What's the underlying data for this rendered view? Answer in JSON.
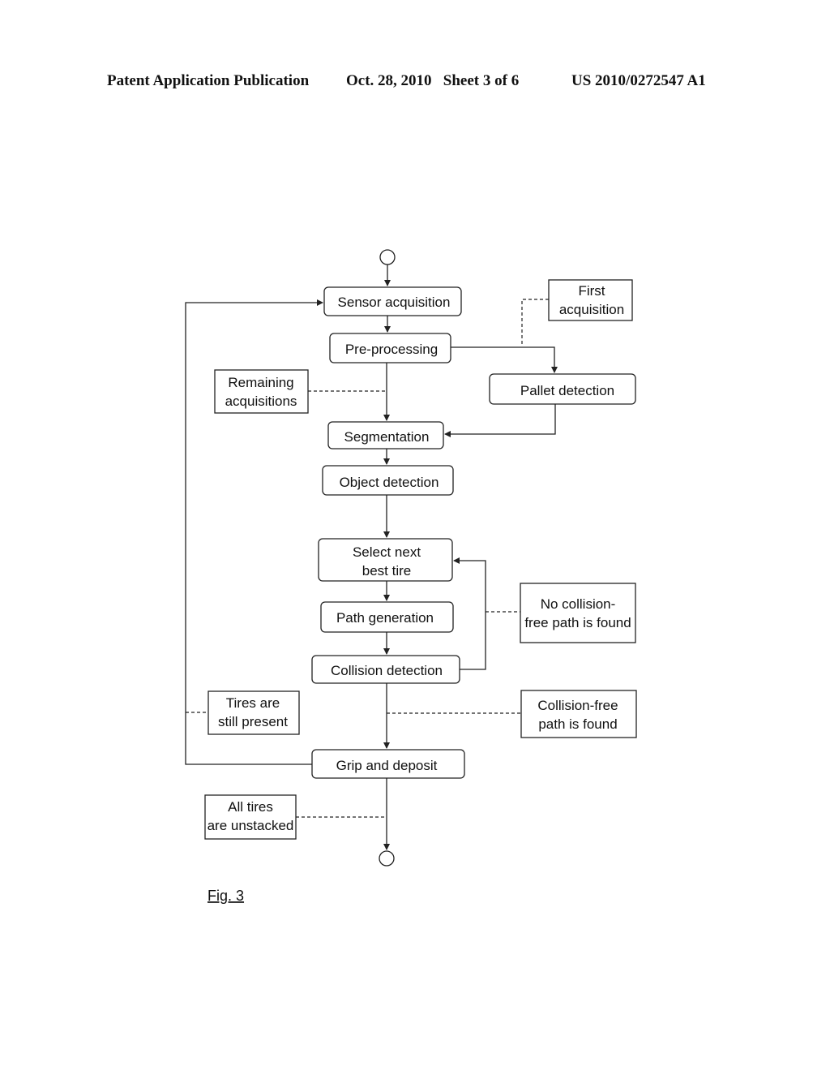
{
  "header": {
    "left": "Patent Application Publication",
    "middle": "Oct. 28, 2010   Sheet 3 of 6",
    "right": "US 2010/0272547 A1"
  },
  "figure_label": "Fig. 3",
  "steps": {
    "sensor_acquisition": "Sensor acquisition",
    "pre_processing": "Pre-processing",
    "pallet_detection": "Pallet detection",
    "segmentation": "Segmentation",
    "object_detection": "Object detection",
    "select_next_line1": "Select next",
    "select_next_line2": "best tire",
    "path_generation": "Path generation",
    "collision_detection": "Collision detection",
    "grip_and_deposit": "Grip and deposit"
  },
  "conditions": {
    "first_acq_line1": "First",
    "first_acq_line2": "acquisition",
    "remaining_line1": "Remaining",
    "remaining_line2": "acquisitions",
    "no_collision_line1": "No collision-",
    "no_collision_line2": "free path is found",
    "collision_free_line1": "Collision-free",
    "collision_free_line2": "path is found",
    "tires_present_line1": "Tires are",
    "tires_present_line2": "still present",
    "all_unstacked_line1": "All tires",
    "all_unstacked_line2": "are unstacked"
  }
}
